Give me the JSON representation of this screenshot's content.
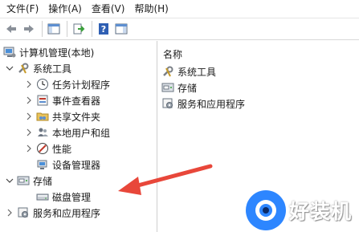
{
  "menu": {
    "file": "文件(F)",
    "action": "操作(A)",
    "view": "查看(V)",
    "help": "帮助(H)"
  },
  "toolbar": {
    "icons": [
      "back-arrow-icon",
      "forward-arrow-icon",
      "show-hide-tree-icon",
      "export-list-icon",
      "help-icon",
      "properties-pane-icon"
    ]
  },
  "tree": {
    "root": "计算机管理(本地)",
    "system_tools": "系统工具",
    "task_scheduler": "任务计划程序",
    "event_viewer": "事件查看器",
    "shared_folders": "共享文件夹",
    "local_users_groups": "本地用户和组",
    "performance": "性能",
    "device_manager": "设备管理器",
    "storage": "存储",
    "disk_management": "磁盘管理",
    "services_apps": "服务和应用程序"
  },
  "content": {
    "column_name": "名称",
    "items": [
      "系统工具",
      "存储",
      "服务和应用程序"
    ]
  },
  "watermark": {
    "text": "好装机"
  },
  "colors": {
    "annotation_arrow": "#e8473a",
    "watermark_blue": "#2d86ff"
  }
}
